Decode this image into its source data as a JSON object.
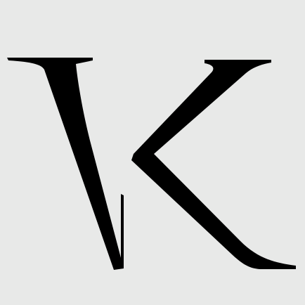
{
  "logo": {
    "icon": "vk-monogram-logo",
    "lettering": "VK",
    "background_color": "#e8e9e8",
    "ink_color": "#000000"
  }
}
